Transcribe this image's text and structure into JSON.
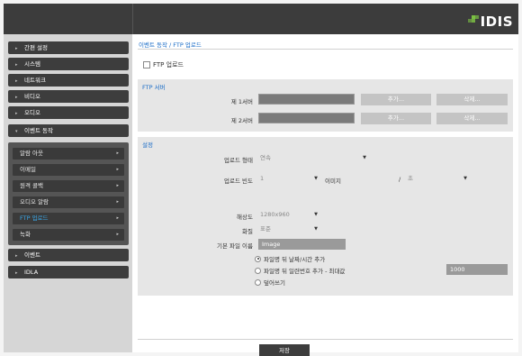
{
  "brand": {
    "logo_text": "IDIS",
    "accent": "#7bc043"
  },
  "sidebar": {
    "items": [
      {
        "label": "간편 설정"
      },
      {
        "label": "시스템"
      },
      {
        "label": "네트워크"
      },
      {
        "label": "비디오"
      },
      {
        "label": "오디오"
      },
      {
        "label": "이벤트 동작"
      },
      {
        "label": "이벤트"
      },
      {
        "label": "IDLA"
      }
    ],
    "submenu": [
      {
        "label": "알람 아웃"
      },
      {
        "label": "이메일"
      },
      {
        "label": "원격 콜백"
      },
      {
        "label": "오디오 알람"
      },
      {
        "label": "FTP 업로드"
      },
      {
        "label": "녹화"
      }
    ]
  },
  "main": {
    "title": "이벤트 동작 / FTP 업로드",
    "enable_label": "FTP 업로드",
    "ftp_server": {
      "title": "FTP 서버",
      "server1_label": "제 1서버",
      "server2_label": "제 2서버",
      "add_label": "추가...",
      "delete_label": "삭제..."
    },
    "settings": {
      "title": "설정",
      "upload_type_label": "업로드 형태",
      "upload_type_value": "연속",
      "upload_rate_label": "업로드 빈도",
      "upload_rate_value": "1",
      "image_label": "이미지",
      "slash": "/",
      "unit_value": "초",
      "resolution_label": "해상도",
      "resolution_value": "1280x960",
      "quality_label": "화질",
      "quality_value": "표준",
      "basename_label": "기본 파일 이름",
      "basename_value": "Image",
      "option1": "파일명 뒤 날짜/시간 추가",
      "option2": "파일명 뒤 일련번호 추가 - 최대값",
      "option2_value": "1000",
      "option3": "덮어쓰기"
    },
    "save_label": "저장"
  },
  "colors": {
    "link": "#1a6cc7",
    "selected_sub": "#3aa7e8"
  }
}
